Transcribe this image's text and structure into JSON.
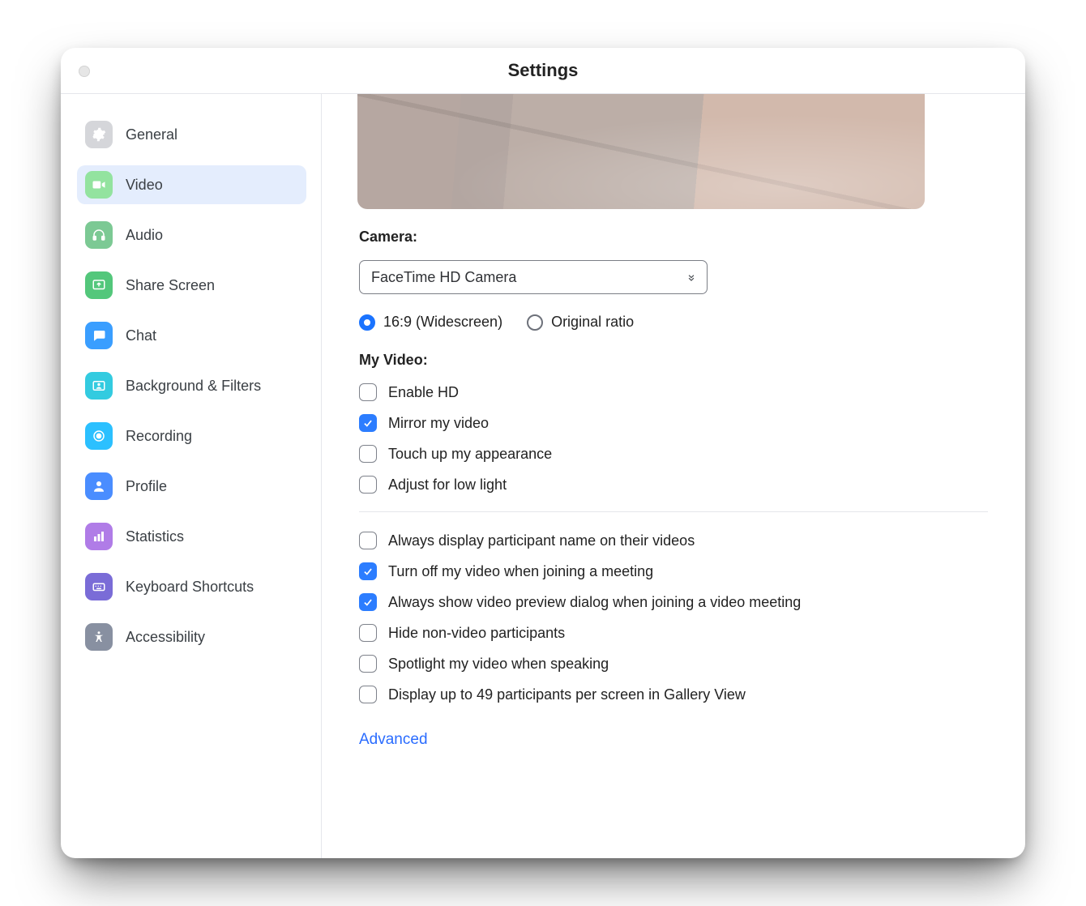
{
  "window": {
    "title": "Settings"
  },
  "sidebar": {
    "items": [
      {
        "key": "general",
        "label": "General",
        "icon": "gear-icon",
        "icon_bg": "#d5d6da",
        "icon_fg": "#ffffff",
        "active": false
      },
      {
        "key": "video",
        "label": "Video",
        "icon": "video-icon",
        "icon_bg": "#93e39f",
        "icon_fg": "#ffffff",
        "active": true
      },
      {
        "key": "audio",
        "label": "Audio",
        "icon": "headphones-icon",
        "icon_bg": "#7cc994",
        "icon_fg": "#ffffff",
        "active": false
      },
      {
        "key": "share",
        "label": "Share Screen",
        "icon": "share-icon",
        "icon_bg": "#53c77b",
        "icon_fg": "#ffffff",
        "active": false
      },
      {
        "key": "chat",
        "label": "Chat",
        "icon": "chat-icon",
        "icon_bg": "#3a9eff",
        "icon_fg": "#ffffff",
        "active": false
      },
      {
        "key": "bgfilters",
        "label": "Background & Filters",
        "icon": "person-card-icon",
        "icon_bg": "#33cbe0",
        "icon_fg": "#ffffff",
        "active": false
      },
      {
        "key": "recording",
        "label": "Recording",
        "icon": "record-icon",
        "icon_bg": "#2bc0ff",
        "icon_fg": "#ffffff",
        "active": false
      },
      {
        "key": "profile",
        "label": "Profile",
        "icon": "profile-icon",
        "icon_bg": "#4a8dff",
        "icon_fg": "#ffffff",
        "active": false
      },
      {
        "key": "statistics",
        "label": "Statistics",
        "icon": "bar-chart-icon",
        "icon_bg": "#b07ce7",
        "icon_fg": "#ffffff",
        "active": false
      },
      {
        "key": "shortcuts",
        "label": "Keyboard Shortcuts",
        "icon": "keyboard-icon",
        "icon_bg": "#7a6cd7",
        "icon_fg": "#ffffff",
        "active": false
      },
      {
        "key": "accessibility",
        "label": "Accessibility",
        "icon": "accessibility-icon",
        "icon_bg": "#8890a1",
        "icon_fg": "#ffffff",
        "active": false
      }
    ]
  },
  "camera": {
    "section_label": "Camera:",
    "selected": "FaceTime HD Camera",
    "ratio_options": [
      {
        "key": "widescreen",
        "label": "16:9 (Widescreen)",
        "checked": true
      },
      {
        "key": "original",
        "label": "Original ratio",
        "checked": false
      }
    ]
  },
  "my_video": {
    "section_label": "My Video:",
    "options": [
      {
        "key": "enable_hd",
        "label": "Enable HD",
        "checked": false
      },
      {
        "key": "mirror",
        "label": "Mirror my video",
        "checked": true
      },
      {
        "key": "touch_up",
        "label": "Touch up my appearance",
        "checked": false
      },
      {
        "key": "low_light",
        "label": "Adjust for low light",
        "checked": false
      }
    ]
  },
  "meeting_options": [
    {
      "key": "display_names",
      "label": "Always display participant name on their videos",
      "checked": false
    },
    {
      "key": "turn_off_on_join",
      "label": "Turn off my video when joining a meeting",
      "checked": true
    },
    {
      "key": "show_preview",
      "label": "Always show video preview dialog when joining a video meeting",
      "checked": true
    },
    {
      "key": "hide_non_video",
      "label": "Hide non-video participants",
      "checked": false
    },
    {
      "key": "spotlight",
      "label": "Spotlight my video when speaking",
      "checked": false
    },
    {
      "key": "gallery_49",
      "label": "Display up to 49 participants per screen in Gallery View",
      "checked": false
    }
  ],
  "advanced_label": "Advanced"
}
